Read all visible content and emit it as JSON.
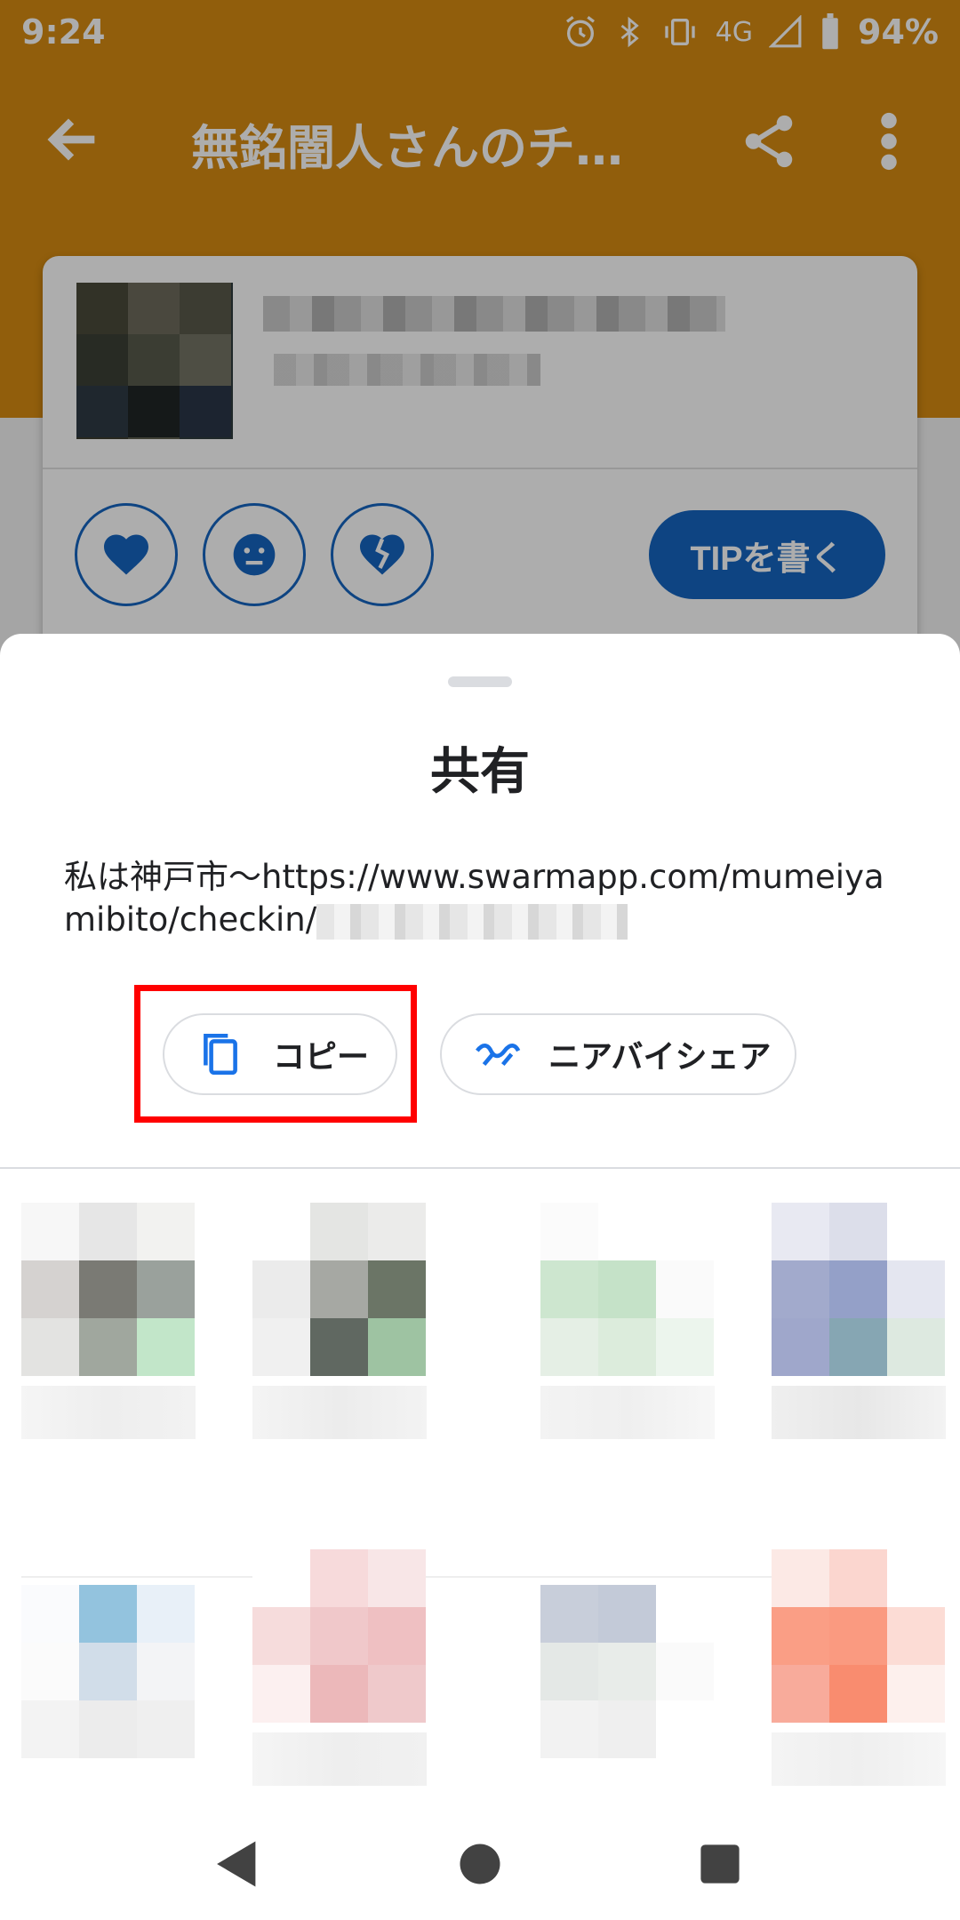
{
  "status_bar": {
    "time": "9:24",
    "network": "4G",
    "battery": "94%"
  },
  "app": {
    "title": "無銘闇人さんのチ…",
    "tip_button": "TIPを書く",
    "accent_color": "#d68b12",
    "primary_color": "#1565c0"
  },
  "share_sheet": {
    "title": "共有",
    "text_visible": "私は神戸市〜https://www.swarmapp.com/mumeiyamibito/checkin/",
    "actions": [
      {
        "label": "コピー",
        "icon": "copy-icon"
      },
      {
        "label": "ニアバイシェア",
        "icon": "nearby-share-icon"
      }
    ],
    "highlight_color": "#ff0000"
  },
  "navigation": {
    "icons": [
      "back-triangle-icon",
      "home-circle-icon",
      "recents-square-icon"
    ]
  }
}
